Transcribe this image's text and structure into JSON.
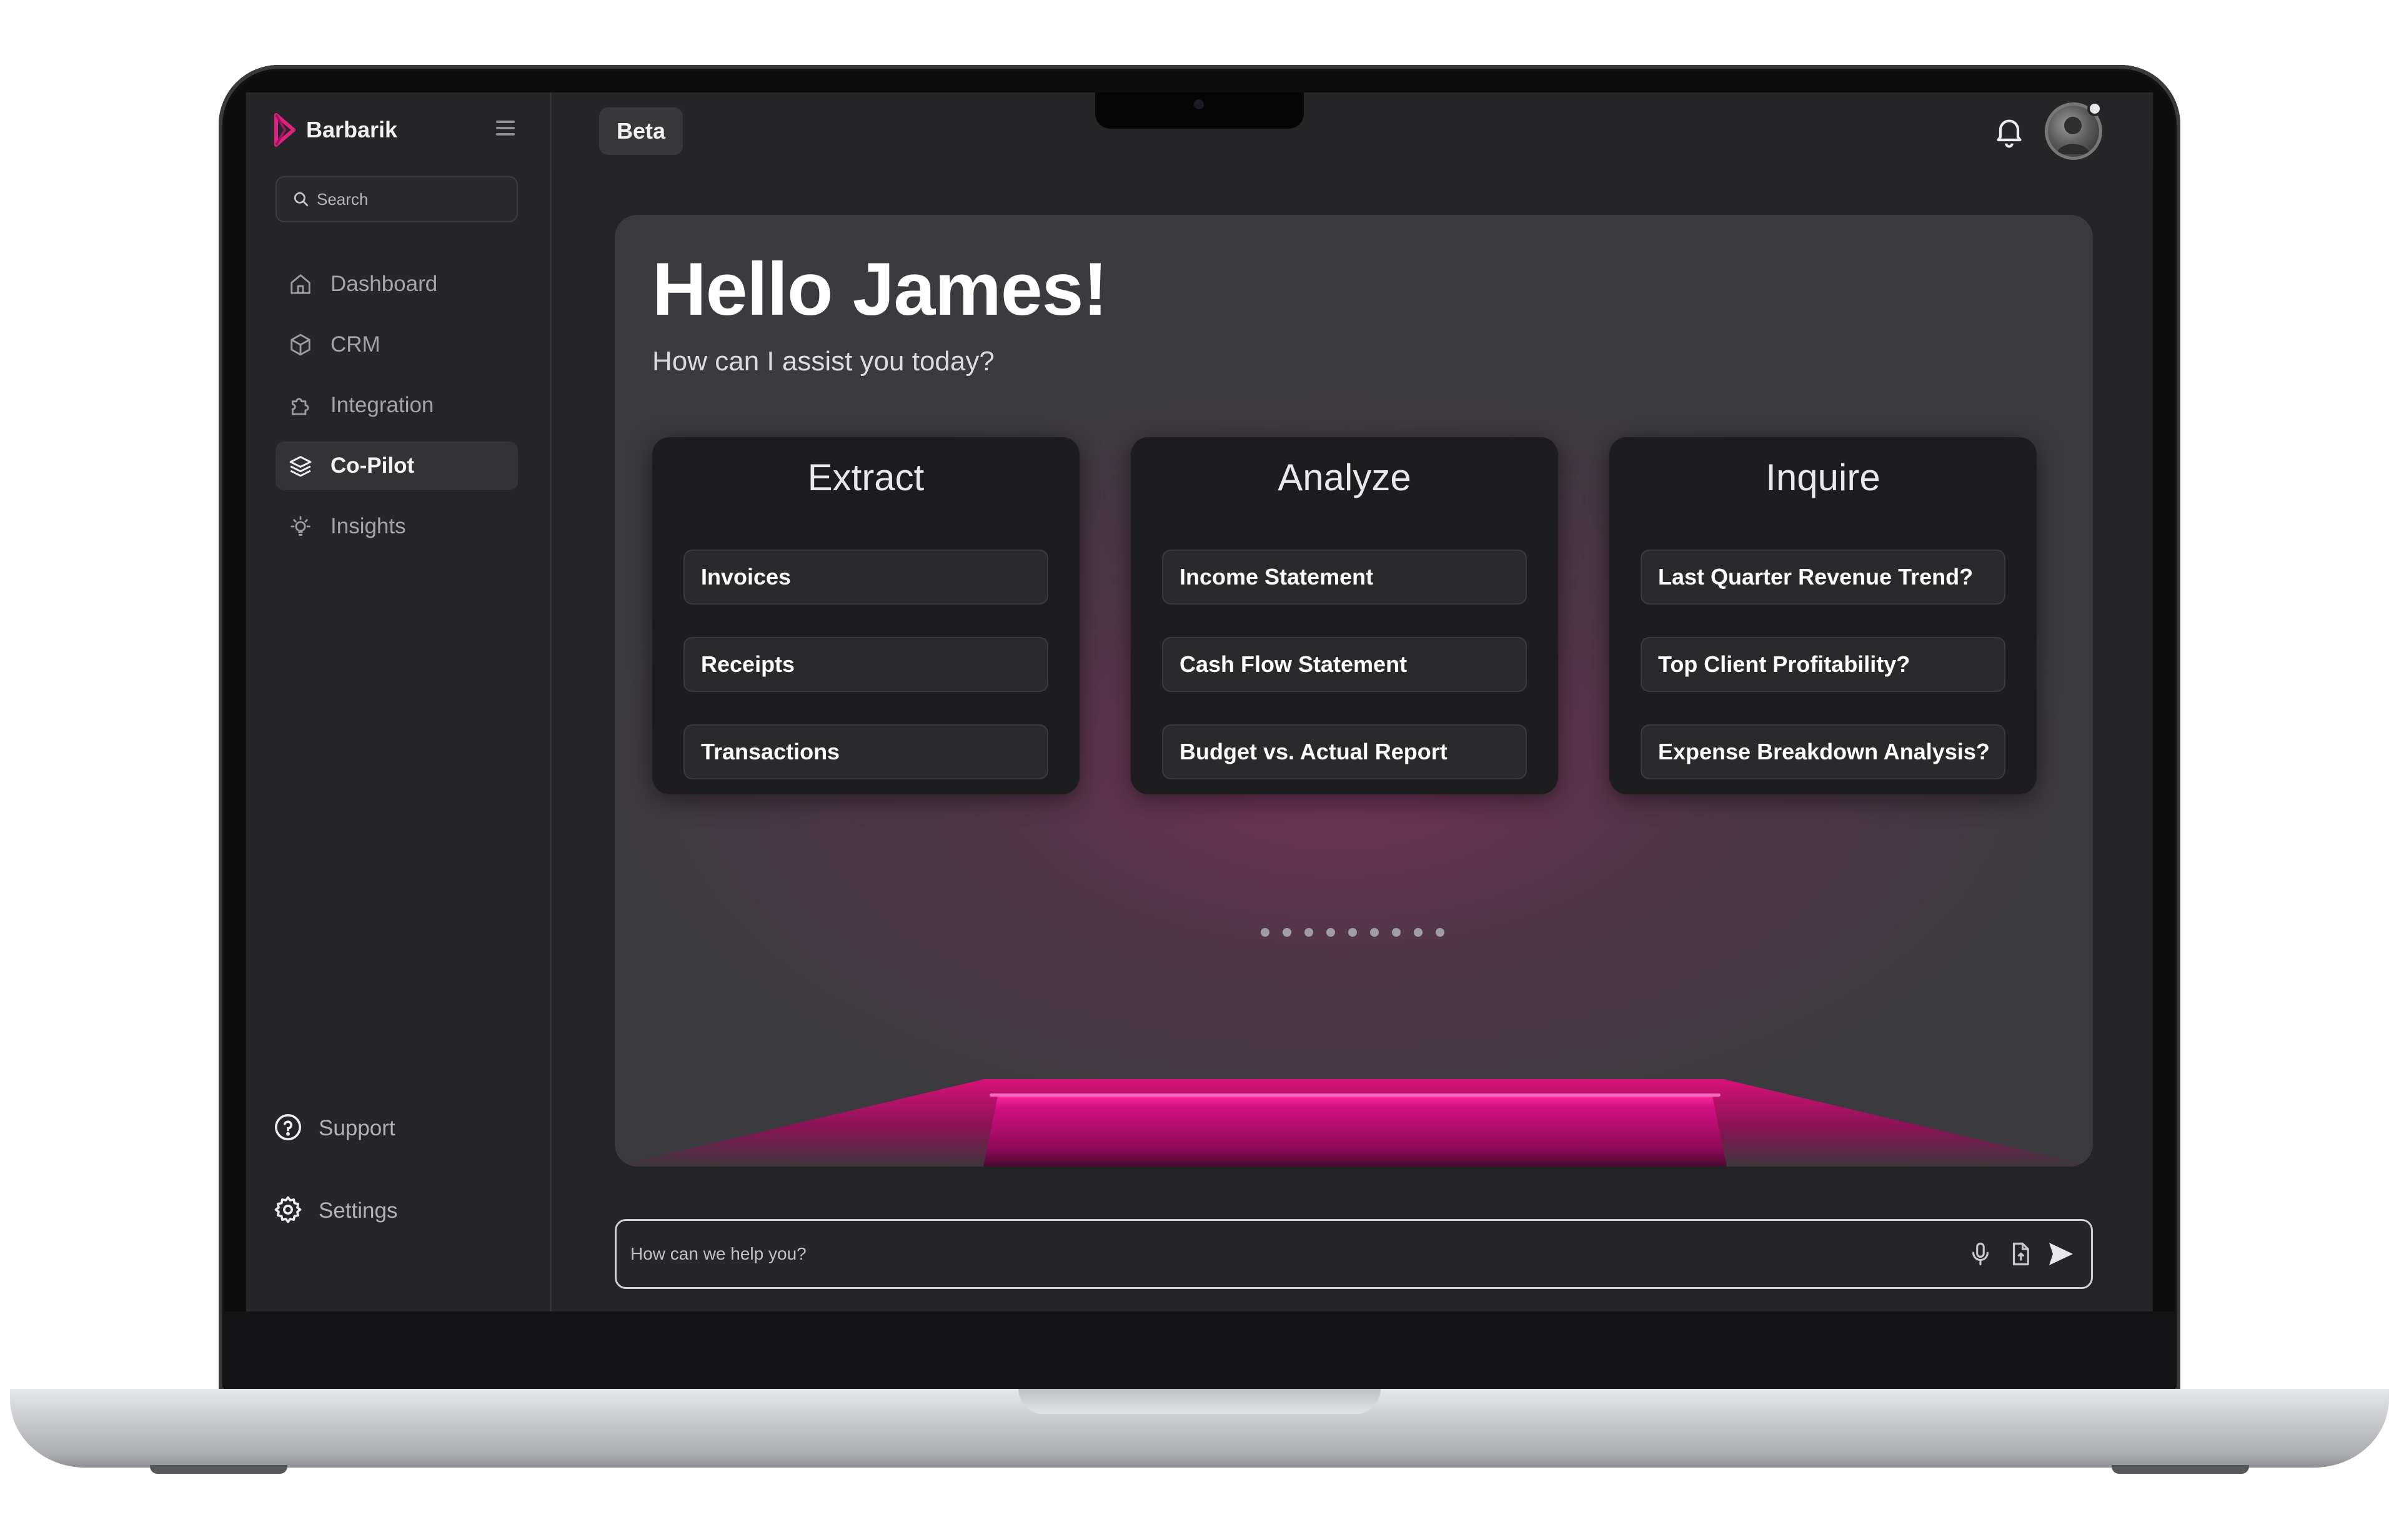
{
  "brand": {
    "name": "Barbarik"
  },
  "search": {
    "placeholder": "Search"
  },
  "sidebar": {
    "items": [
      {
        "label": "Dashboard",
        "icon": "home-icon",
        "active": false
      },
      {
        "label": "CRM",
        "icon": "cube-icon",
        "active": false
      },
      {
        "label": "Integration",
        "icon": "puzzle-icon",
        "active": false
      },
      {
        "label": "Co-Pilot",
        "icon": "layers-icon",
        "active": true
      },
      {
        "label": "Insights",
        "icon": "lightbulb-icon",
        "active": false
      }
    ],
    "bottom": [
      {
        "label": "Support",
        "icon": "help-circle-icon"
      },
      {
        "label": "Settings",
        "icon": "gear-icon"
      }
    ]
  },
  "header": {
    "badge": "Beta"
  },
  "main": {
    "greeting": "Hello James!",
    "subtitle": "How can I assist you today?",
    "cards": [
      {
        "title": "Extract",
        "options": [
          "Invoices",
          "Receipts",
          "Transactions"
        ]
      },
      {
        "title": "Analyze",
        "options": [
          "Income Statement",
          "Cash Flow Statement",
          "Budget vs. Actual Report"
        ]
      },
      {
        "title": "Inquire",
        "options": [
          "Last Quarter Revenue Trend?",
          "Top Client Profitability?",
          "Expense Breakdown Analysis?"
        ]
      }
    ]
  },
  "chat": {
    "placeholder": "How can we help you?"
  },
  "colors": {
    "accent": "#d40f82",
    "brand_logo": "#e0207f",
    "background": "#252527",
    "card": "#1d1d1f"
  }
}
